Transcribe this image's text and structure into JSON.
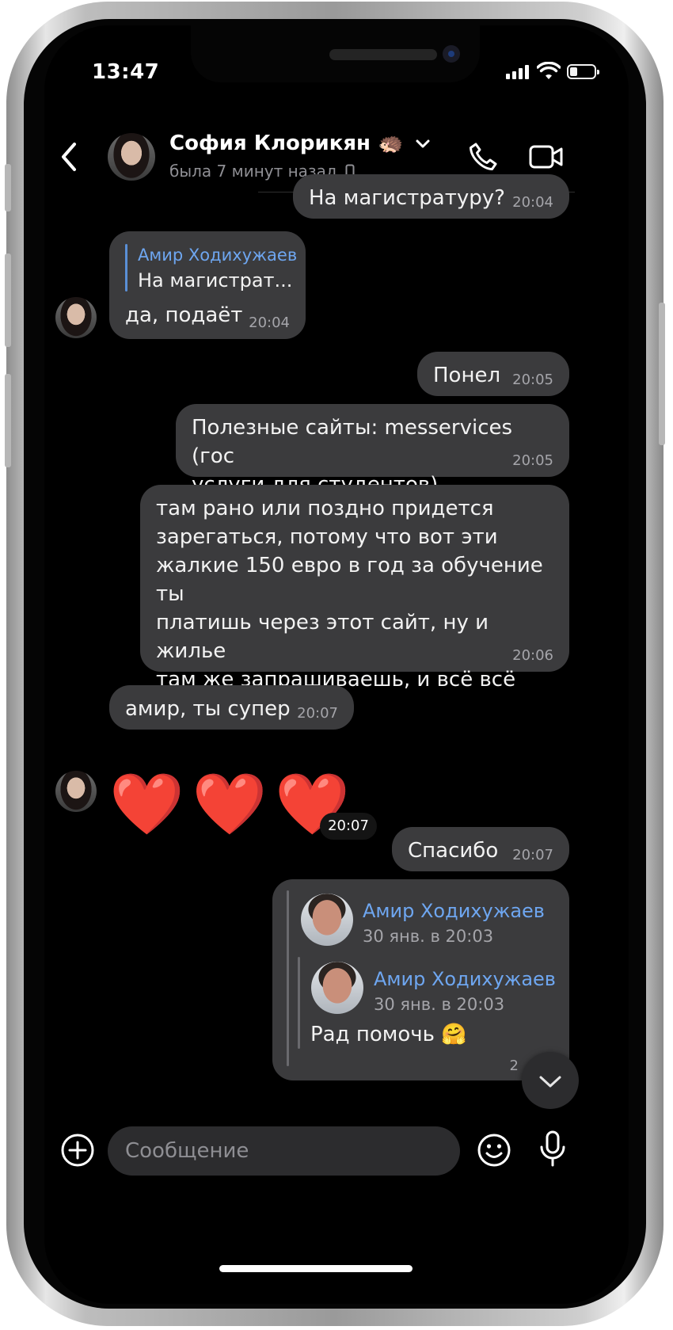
{
  "status_bar": {
    "time": "13:47"
  },
  "header": {
    "contact_name": "София Клорикян 🦔",
    "last_seen": "была 7 минут назад"
  },
  "messages": {
    "m1": {
      "text": "На магистратуру?",
      "time": "20:04"
    },
    "m2": {
      "reply_author": "Амир Ходихужаев",
      "reply_text": "На магистрат...",
      "text": "да, подаёт",
      "time": "20:04"
    },
    "m3": {
      "text": "Понел",
      "time": "20:05"
    },
    "m4": {
      "text": "Полезные сайты: messervices (гос\nуслуги для студентов)",
      "time": "20:05"
    },
    "m5": {
      "text": "там рано или поздно придется\nзарегаться, потому что вот эти\nжалкие 150 евро в год за обучение ты\nплатишь через этот сайт, ну и жилье\nтам же запрашиваешь, и всё всё\nпочти там",
      "time": "20:06"
    },
    "m6": {
      "text": "амир, ты супер",
      "time": "20:07"
    },
    "m7": {
      "emoji": "❤️❤️❤️",
      "time": "20:07"
    },
    "m8": {
      "text": "Спасибо",
      "time": "20:07"
    },
    "m9": {
      "fwd_author": "Амир Ходихужаев",
      "fwd_date": "30 янв. в 20:03",
      "nested_author": "Амир Ходихужаев",
      "nested_date": "30 янв. в 20:03",
      "text": "Рад помочь 🤗",
      "time_partial": "2"
    }
  },
  "composer": {
    "placeholder": "Сообщение"
  }
}
